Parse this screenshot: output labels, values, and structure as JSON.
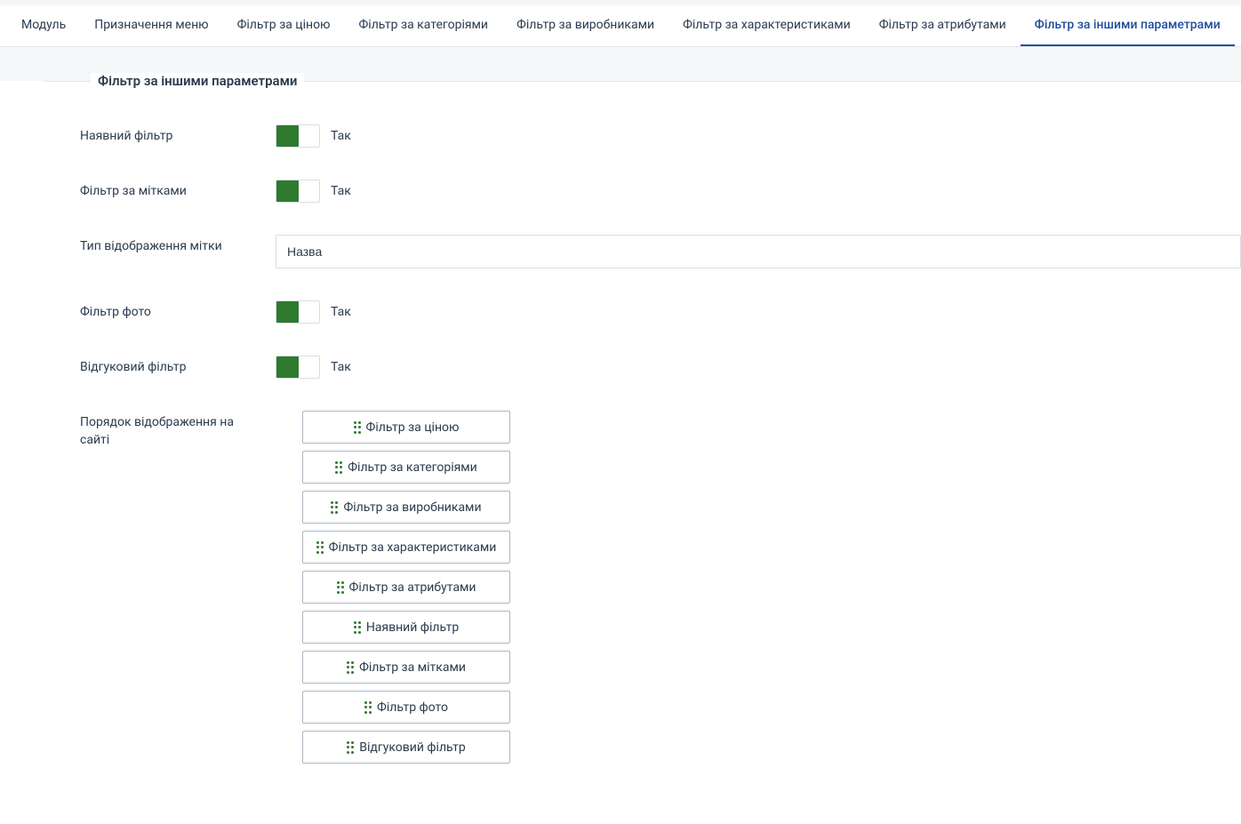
{
  "tabs": [
    {
      "label": "Модуль",
      "active": false
    },
    {
      "label": "Призначення меню",
      "active": false
    },
    {
      "label": "Фільтр за ціною",
      "active": false
    },
    {
      "label": "Фільтр за категоріями",
      "active": false
    },
    {
      "label": "Фільтр за виробниками",
      "active": false
    },
    {
      "label": "Фільтр за характеристиками",
      "active": false
    },
    {
      "label": "Фільтр за атрибутами",
      "active": false
    },
    {
      "label": "Фільтр за іншими параметрами",
      "active": true
    }
  ],
  "fieldset_title": "Фільтр за іншими параметрами",
  "rows": {
    "available_filter": {
      "label": "Наявний фільтр",
      "state": "Так"
    },
    "tags_filter": {
      "label": "Фільтр за мітками",
      "state": "Так"
    },
    "tag_display_type": {
      "label": "Тип відображення мітки",
      "value": "Назва"
    },
    "photo_filter": {
      "label": "Фільтр фото",
      "state": "Так"
    },
    "review_filter": {
      "label": "Відгуковий фільтр",
      "state": "Так"
    },
    "sort_order": {
      "label": "Порядок відображення на сайті"
    }
  },
  "sort_items": [
    "Фільтр за ціною",
    "Фільтр за категоріями",
    "Фільтр за виробниками",
    "Фільтр за характеристиками",
    "Фільтр за атрибутами",
    "Наявний фільтр",
    "Фільтр за мітками",
    "Фільтр фото",
    "Відгуковий фільтр"
  ]
}
